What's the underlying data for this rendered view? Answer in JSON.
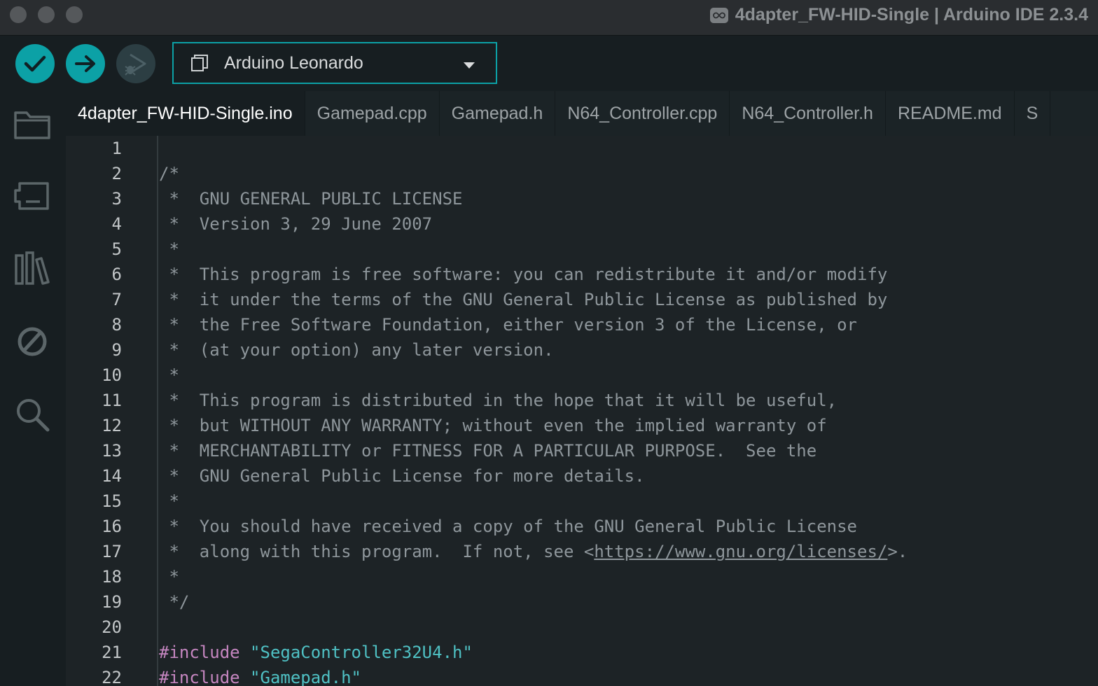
{
  "window": {
    "title": "4dapter_FW-HID-Single | Arduino IDE 2.3.4",
    "title_icon": "infinity-icon"
  },
  "toolbar": {
    "verify_icon": "check-icon",
    "upload_icon": "arrow-right-icon",
    "debug_icon": "debug-play-icon",
    "board": {
      "label": "Arduino Leonardo",
      "icon": "board-icon",
      "caret": "caret-down-icon"
    }
  },
  "sidebar": {
    "items": [
      {
        "name": "sketchbook",
        "icon": "folder-icon"
      },
      {
        "name": "boards-manager",
        "icon": "board-manager-icon"
      },
      {
        "name": "library-manager",
        "icon": "library-icon"
      },
      {
        "name": "debug",
        "icon": "no-debug-icon"
      },
      {
        "name": "search",
        "icon": "search-icon"
      }
    ]
  },
  "tabs": [
    {
      "label": "4dapter_FW-HID-Single.ino",
      "active": true
    },
    {
      "label": "Gamepad.cpp",
      "active": false
    },
    {
      "label": "Gamepad.h",
      "active": false
    },
    {
      "label": "N64_Controller.cpp",
      "active": false
    },
    {
      "label": "N64_Controller.h",
      "active": false
    },
    {
      "label": "README.md",
      "active": false
    },
    {
      "label": "S",
      "active": false
    }
  ],
  "editor": {
    "lines": [
      {
        "num": "1",
        "parts": [
          {
            "t": ""
          }
        ]
      },
      {
        "num": "2",
        "parts": [
          {
            "t": "/*"
          }
        ]
      },
      {
        "num": "3",
        "parts": [
          {
            "t": " *  GNU GENERAL PUBLIC LICENSE"
          }
        ]
      },
      {
        "num": "4",
        "parts": [
          {
            "t": " *  Version 3, 29 June 2007"
          }
        ]
      },
      {
        "num": "5",
        "parts": [
          {
            "t": " *"
          }
        ]
      },
      {
        "num": "6",
        "parts": [
          {
            "t": " *  This program is free software: you can redistribute it and/or modify"
          }
        ]
      },
      {
        "num": "7",
        "parts": [
          {
            "t": " *  it under the terms of the GNU General Public License as published by"
          }
        ]
      },
      {
        "num": "8",
        "parts": [
          {
            "t": " *  the Free Software Foundation, either version 3 of the License, or"
          }
        ]
      },
      {
        "num": "9",
        "parts": [
          {
            "t": " *  (at your option) any later version."
          }
        ]
      },
      {
        "num": "10",
        "parts": [
          {
            "t": " *"
          }
        ]
      },
      {
        "num": "11",
        "parts": [
          {
            "t": " *  This program is distributed in the hope that it will be useful,"
          }
        ]
      },
      {
        "num": "12",
        "parts": [
          {
            "t": " *  but WITHOUT ANY WARRANTY; without even the implied warranty of"
          }
        ]
      },
      {
        "num": "13",
        "parts": [
          {
            "t": " *  MERCHANTABILITY or FITNESS FOR A PARTICULAR PURPOSE.  See the"
          }
        ]
      },
      {
        "num": "14",
        "parts": [
          {
            "t": " *  GNU General Public License for more details."
          }
        ]
      },
      {
        "num": "15",
        "parts": [
          {
            "t": " *"
          }
        ]
      },
      {
        "num": "16",
        "parts": [
          {
            "t": " *  You should have received a copy of the GNU General Public License"
          }
        ]
      },
      {
        "num": "17",
        "parts": [
          {
            "t": " *  along with this program.  If not, see <"
          },
          {
            "t": "https://www.gnu.org/licenses/",
            "c": "lnk"
          },
          {
            "t": ">."
          }
        ]
      },
      {
        "num": "18",
        "parts": [
          {
            "t": " *"
          }
        ]
      },
      {
        "num": "19",
        "parts": [
          {
            "t": " */"
          }
        ]
      },
      {
        "num": "20",
        "parts": [
          {
            "t": ""
          }
        ]
      },
      {
        "num": "21",
        "parts": [
          {
            "t": "#include",
            "c": "kw"
          },
          {
            "t": " "
          },
          {
            "t": "\"SegaController32U4.h\"",
            "c": "str"
          }
        ]
      },
      {
        "num": "22",
        "parts": [
          {
            "t": "#include",
            "c": "kw"
          },
          {
            "t": " "
          },
          {
            "t": "\"Gamepad.h\"",
            "c": "str"
          }
        ]
      }
    ]
  },
  "colors": {
    "accent": "#0ca1a6",
    "background": "#171e21",
    "keyword": "#c586c0",
    "string": "#4fc1c4",
    "comment": "#8e969b"
  }
}
